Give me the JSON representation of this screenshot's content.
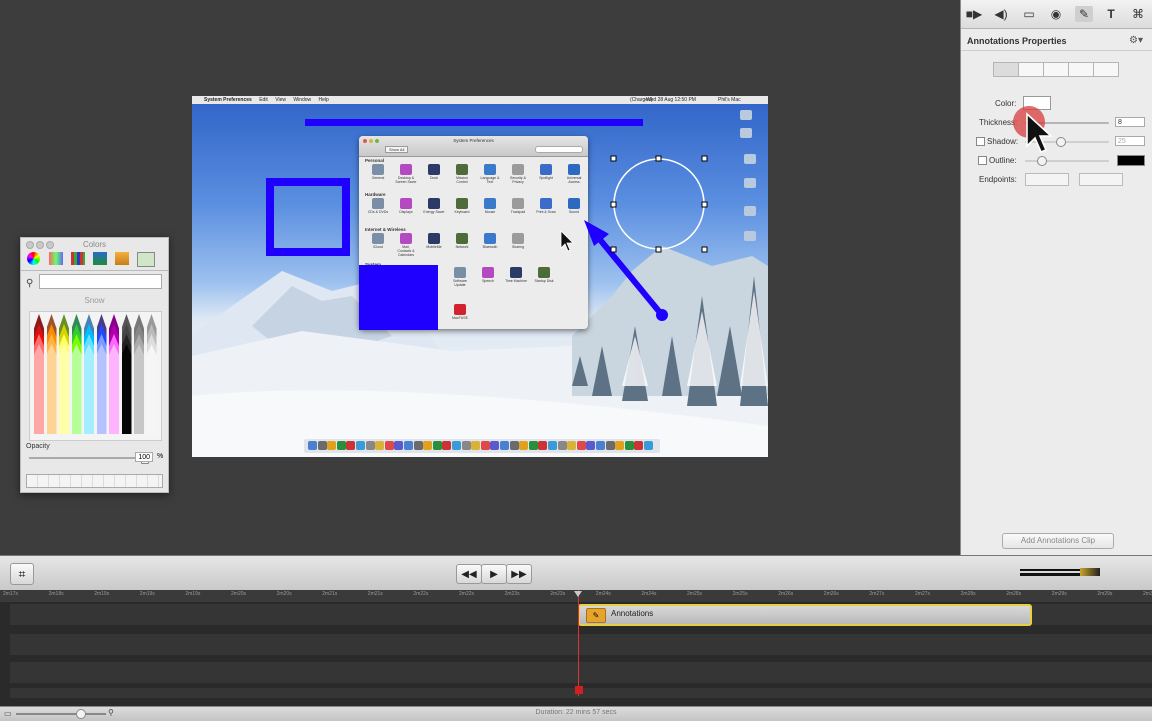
{
  "canvas": {
    "menubar": {
      "items": [
        "System Preferences",
        "Edit",
        "View",
        "Window",
        "Help"
      ],
      "clock": "Wed 28 Aug  12:50 PM",
      "battery": "(Charged)",
      "user": "Phil's Mac"
    },
    "system_preferences": {
      "title": "System Preferences",
      "show_all": "Show All",
      "sections": [
        "Personal",
        "Hardware",
        "Internet & Wireless",
        "System"
      ],
      "personal": [
        "General",
        "Desktop & Screen Saver",
        "Dock",
        "Mission Control",
        "Language & Text",
        "Security & Privacy",
        "Spotlight",
        "Universal Access"
      ],
      "hardware": [
        "CDs & DVDs",
        "Displays",
        "Energy Saver",
        "Keyboard",
        "Mouse",
        "Trackpad",
        "Print & Scan",
        "Sound"
      ],
      "internet": [
        "iCloud",
        "Mail, Contacts & Calendars",
        "MobileMe",
        "Network",
        "Bluetooth",
        "Sharing"
      ],
      "system": [
        "Software Update",
        "Speech",
        "Time Machine",
        "Startup Disk"
      ],
      "other": [
        "MacFUSE"
      ]
    }
  },
  "colors_panel": {
    "title": "Colors",
    "search_placeholder": "",
    "selected_name": "Snow",
    "opacity_label": "Opacity",
    "opacity_value": "100",
    "opacity_unit": "%",
    "opacity": 1.0
  },
  "inspector": {
    "toolbar_icons": [
      "video-icon",
      "audio-icon",
      "screen-icon",
      "cursor-icon",
      "annotations-icon",
      "text-icon",
      "keystroke-icon"
    ],
    "title": "Annotations Properties",
    "color_label": "Color:",
    "thickness_label": "Thickness:",
    "thickness_value": "8",
    "shadow_label": "Shadow:",
    "shadow_value": "25",
    "outline_label": "Outline:",
    "endpoints_label": "Endpoints:",
    "add_clip_button": "Add Annotations Clip",
    "accent_color": "#1f00ff"
  },
  "timeline": {
    "ruler_ticks": [
      "2m17s",
      "2m18s",
      "2m19s",
      "2m19s",
      "2m19s",
      "2m20s",
      "2m20s",
      "2m21s",
      "2m21s",
      "2m22s",
      "2m22s",
      "2m23s",
      "2m23s",
      "2m24s",
      "2m24s",
      "2m25s",
      "2m25s",
      "2m26s",
      "2m26s",
      "2m27s",
      "2m27s",
      "2m28s",
      "2m28s",
      "2m29s",
      "2m29s",
      "2m30s"
    ],
    "clip_label": "Annotations",
    "clip_color": "#e6cf42",
    "duration": "Duration: 22 mins 57 secs"
  }
}
